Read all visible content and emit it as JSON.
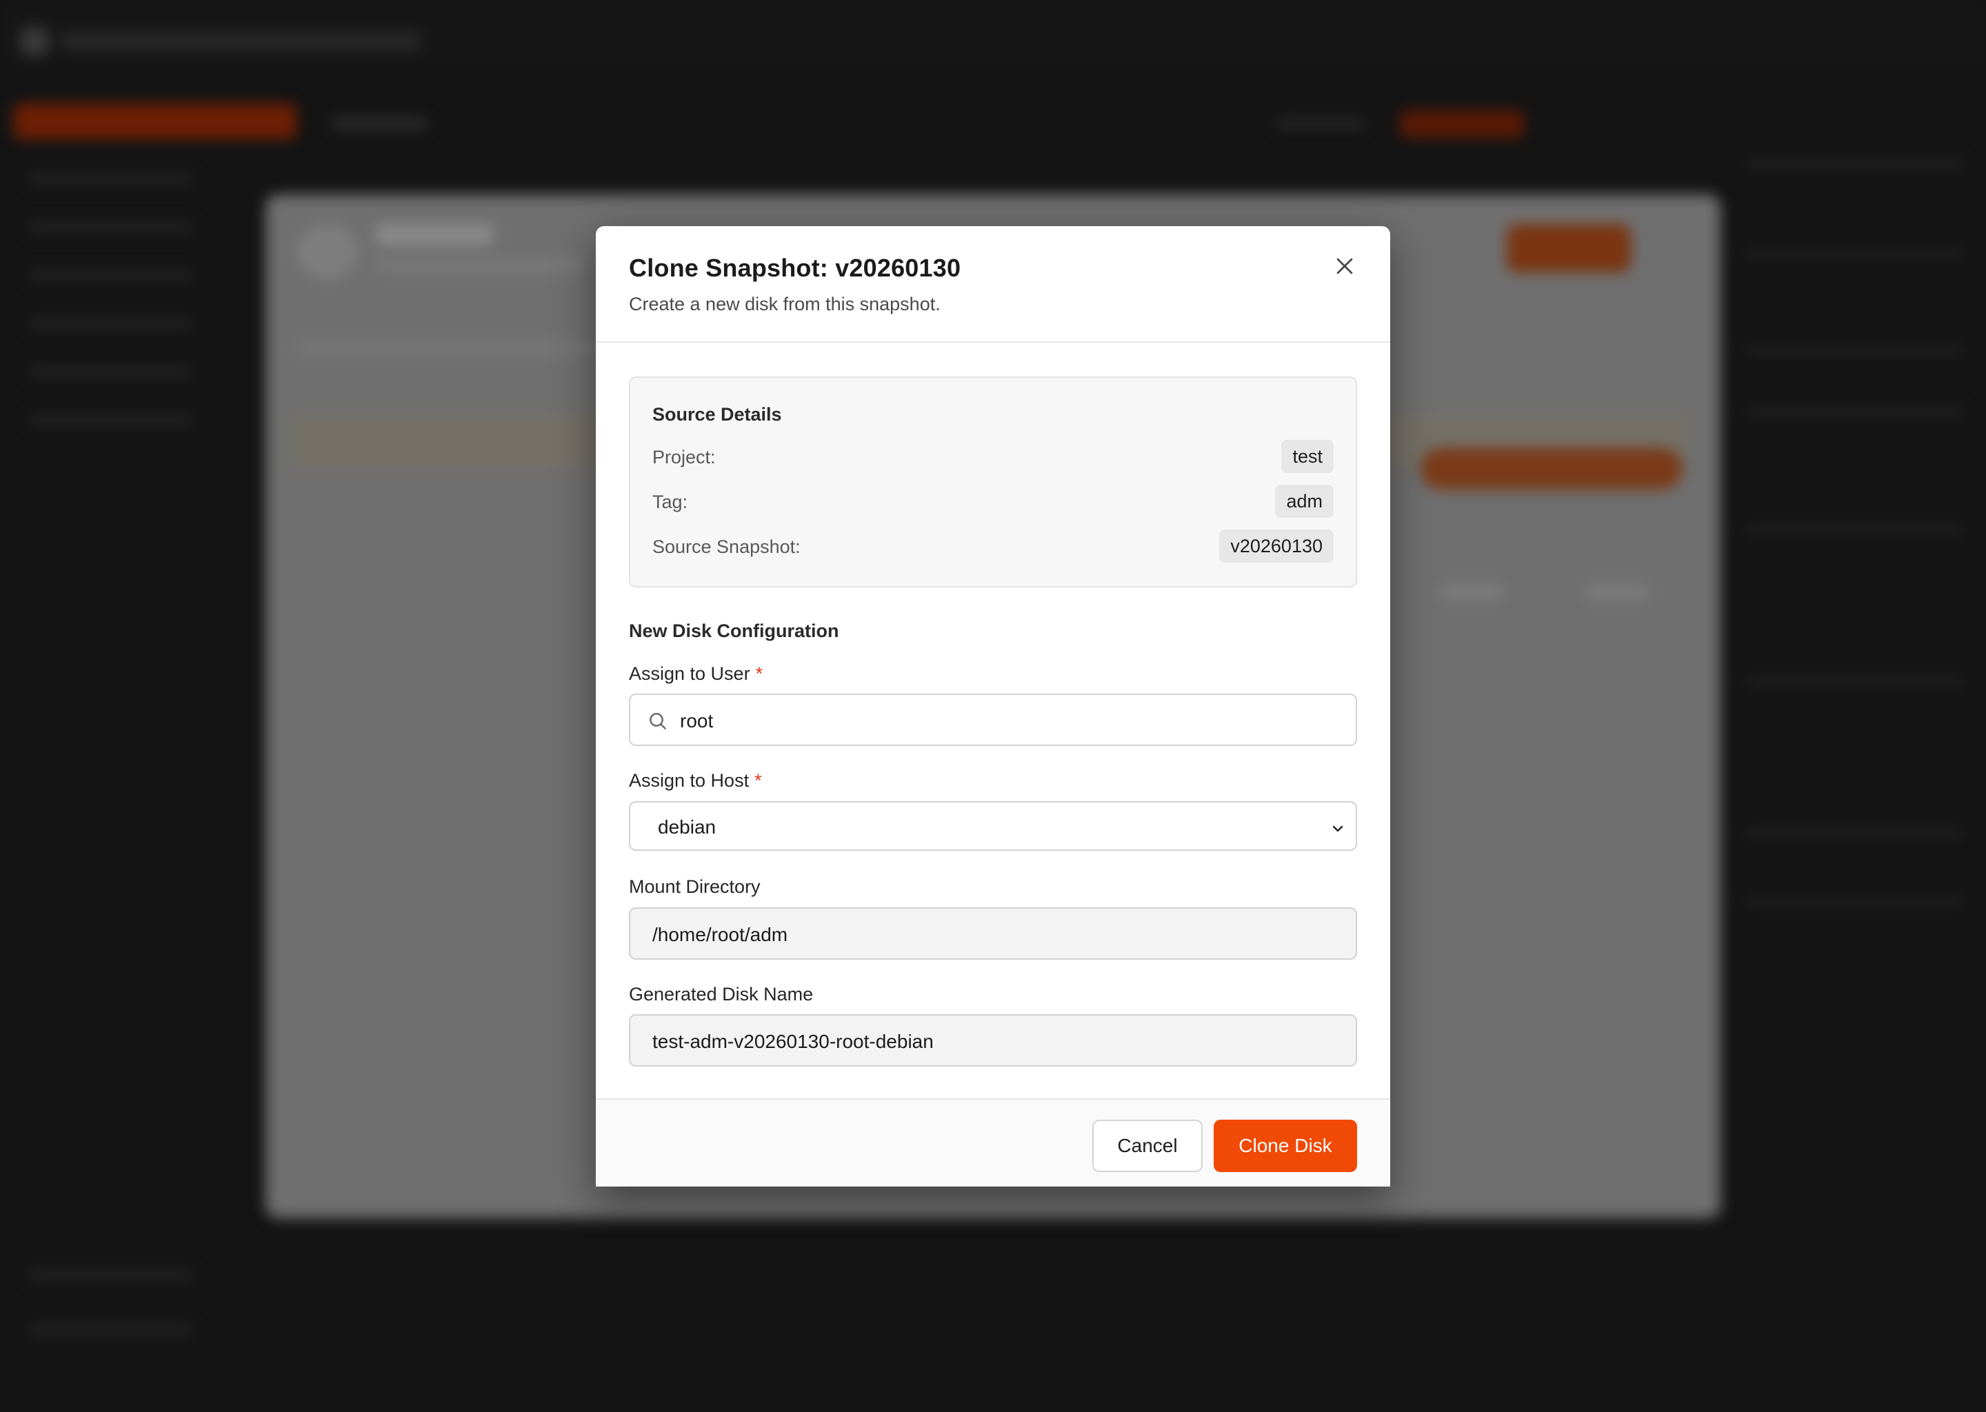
{
  "modal": {
    "title": "Clone Snapshot: v20260130",
    "subtitle": "Create a new disk from this snapshot."
  },
  "source_details": {
    "heading": "Source Details",
    "rows": [
      {
        "label": "Project:",
        "value": "test"
      },
      {
        "label": "Tag:",
        "value": "adm"
      },
      {
        "label": "Source Snapshot:",
        "value": "v20260130"
      }
    ]
  },
  "config": {
    "heading": "New Disk Configuration",
    "user": {
      "label": "Assign to User",
      "required_mark": "*",
      "value": "root",
      "icon": "search-icon"
    },
    "host": {
      "label": "Assign to Host",
      "required_mark": "*",
      "value": "debian",
      "icon": "chevron-down-icon"
    },
    "mount": {
      "label": "Mount Directory",
      "value": "/home/root/adm"
    },
    "disk_name": {
      "label": "Generated Disk Name",
      "value": "test-adm-v20260130-root-debian"
    }
  },
  "footer": {
    "cancel_label": "Cancel",
    "clone_label": "Clone Disk"
  },
  "colors": {
    "accent": "#f04a06",
    "overlay": "#141414",
    "required": "#e03a1e"
  }
}
